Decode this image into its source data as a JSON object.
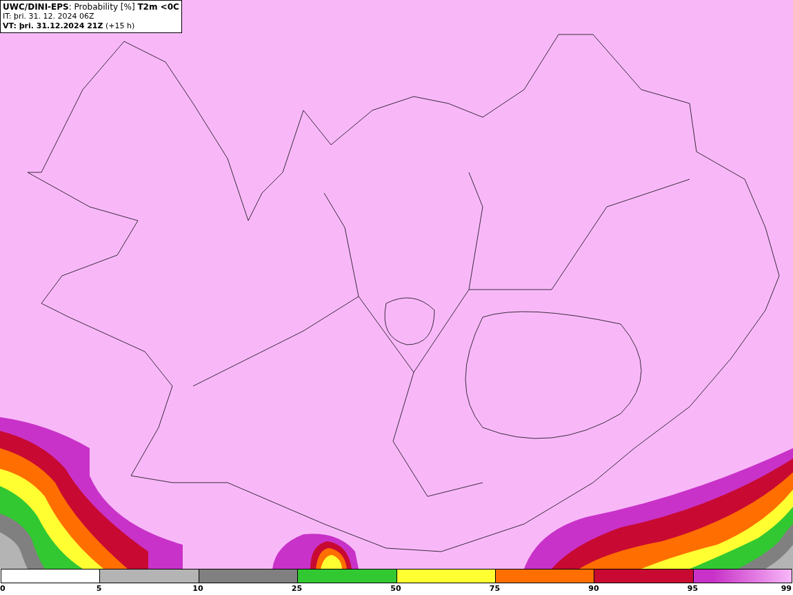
{
  "title_box": {
    "lines": [
      "**UWC/DINI-EPS**: Probability [%] **T2m <0C**",
      "IT: þri. 31. 12. 2024 06Z",
      "**VT: þri. 31.12.2024 21Z** (+15 h)"
    ]
  },
  "legend": {
    "segments": [
      {
        "color": "#ffffff",
        "kind": "solid"
      },
      {
        "color": "#b4b4b4",
        "kind": "solid"
      },
      {
        "color": "#808080",
        "kind": "solid"
      },
      {
        "color": "#32c832",
        "kind": "solid"
      },
      {
        "color": "#ffff32",
        "kind": "solid"
      },
      {
        "color": "#ff6e00",
        "kind": "solid"
      },
      {
        "color": "#c80a32",
        "kind": "solid"
      },
      {
        "color": "#c832c8",
        "kind": "gradient"
      }
    ],
    "ticks": [
      "0",
      "5",
      "10",
      "25",
      "50",
      "75",
      "90",
      "95",
      "99"
    ]
  }
}
